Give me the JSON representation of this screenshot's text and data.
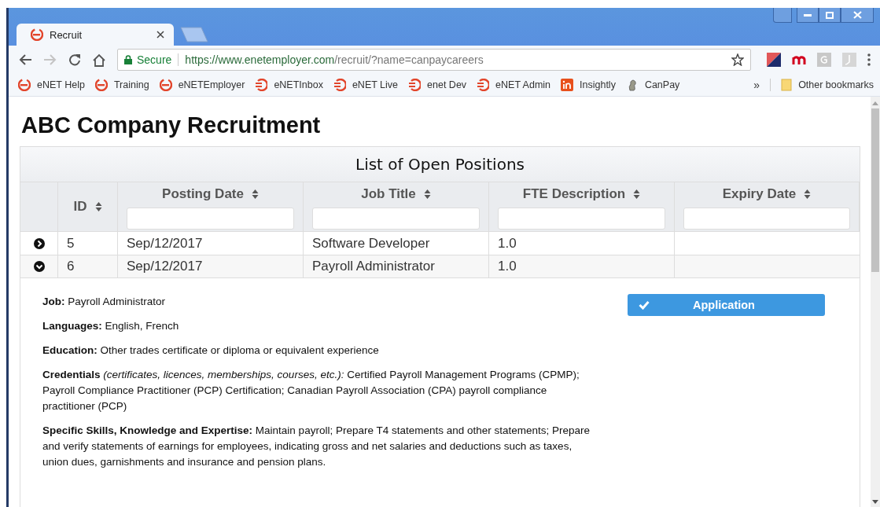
{
  "browser": {
    "tab": {
      "title": "Recruit"
    },
    "address": {
      "secure_label": "Secure",
      "url_host": "https://www.enetemployer.com",
      "url_path": "/recruit/?name=canpaycareers"
    },
    "bookmarks": [
      {
        "label": "eNET Help",
        "kind": "enet"
      },
      {
        "label": "Training",
        "kind": "enet"
      },
      {
        "label": "eNETEmployer",
        "kind": "enet"
      },
      {
        "label": "eNETInbox",
        "kind": "enet-alt"
      },
      {
        "label": "eNET Live",
        "kind": "enet-alt"
      },
      {
        "label": "enet Dev",
        "kind": "enet-alt"
      },
      {
        "label": "eNET Admin",
        "kind": "enet-alt"
      },
      {
        "label": "Insightly",
        "kind": "insightly"
      },
      {
        "label": "CanPay",
        "kind": "canpay"
      }
    ],
    "overflow": "»",
    "other_bookmarks": "Other bookmarks"
  },
  "page": {
    "title": "ABC Company Recruitment",
    "table": {
      "caption": "List of Open Positions",
      "columns": [
        {
          "label": "ID"
        },
        {
          "label": "Posting Date"
        },
        {
          "label": "Job Title"
        },
        {
          "label": "FTE Description"
        },
        {
          "label": "Expiry Date"
        }
      ],
      "rows": [
        {
          "expanded": false,
          "cells": [
            "5",
            "Sep/12/2017",
            "Software Developer",
            "1.0",
            ""
          ]
        },
        {
          "expanded": true,
          "cells": [
            "6",
            "Sep/12/2017",
            "Payroll Administrator",
            "1.0",
            ""
          ]
        }
      ]
    },
    "details": {
      "paragraphs": [
        "**Job:**  Payroll Administrator",
        "**Languages:**  English, French",
        "**Education:**  Other trades certificate or diploma or equivalent experience",
        "**Credentials** *(certificates, licences, memberships, courses, etc.):*  Certified Payroll Management Programs (CPMP); Payroll Compliance Practitioner (PCP) Certification; Canadian Payroll Association (CPA) payroll compliance practitioner (PCP)",
        "**Specific Skills, Knowledge and Expertise:**  Maintain payroll; Prepare T4 statements and other statements; Prepare and verify statements of earnings for employees, indicating gross and net salaries and deductions such as taxes, union dues, garnishments and insurance and pension plans."
      ],
      "button": "Application"
    }
  }
}
